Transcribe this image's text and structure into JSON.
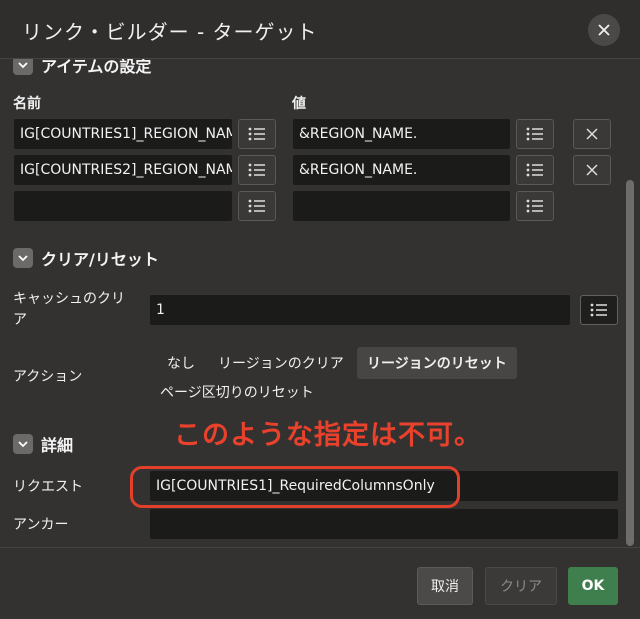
{
  "dialog": {
    "title": "リンク・ビルダー - ターゲット",
    "close_icon": "close-icon"
  },
  "items_section": {
    "title": "アイテムの設定",
    "name_header": "名前",
    "value_header": "値",
    "rows": [
      {
        "name": "IG[COUNTRIES1]_REGION_NAM",
        "value": "&REGION_NAME."
      },
      {
        "name": "IG[COUNTRIES2]_REGION_NAM",
        "value": "&REGION_NAME."
      },
      {
        "name": "",
        "value": ""
      }
    ]
  },
  "clear_section": {
    "title": "クリア/リセット",
    "cache_label": "キャッシュのクリア",
    "cache_value": "1",
    "action_label": "アクション",
    "action_options": [
      "なし",
      "リージョンのクリア",
      "リージョンのリセット",
      "ページ区切りのリセット"
    ],
    "action_selected": "リージョンのリセット"
  },
  "detail_section": {
    "title": "詳細",
    "request_label": "リクエスト",
    "request_value": "IG[COUNTRIES1]_RequiredColumnsOnly",
    "anchor_label": "アンカー",
    "anchor_value": ""
  },
  "annotation": {
    "text": "このような指定は不可。",
    "color": "#e8412c"
  },
  "footer": {
    "cancel_label": "取消",
    "clear_label": "クリア",
    "ok_label": "OK"
  },
  "colors": {
    "ok_button": "#3f7f4d",
    "background": "#333231"
  }
}
